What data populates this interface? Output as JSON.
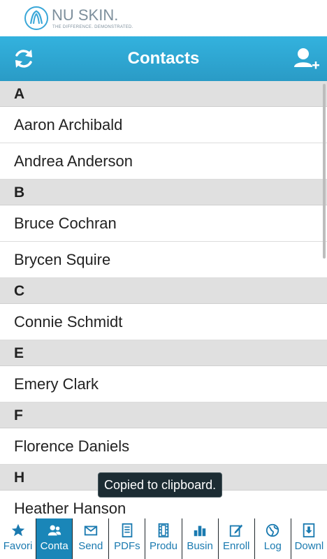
{
  "brand": {
    "name": "NU SKIN.",
    "tagline": "THE DIFFERENCE. DEMONSTRATED."
  },
  "header": {
    "title": "Contacts",
    "refresh_icon": "refresh-icon",
    "add_icon": "add-contact-icon"
  },
  "contacts": {
    "sections": [
      {
        "letter": "A",
        "names": [
          "Aaron Archibald",
          "Andrea Anderson"
        ]
      },
      {
        "letter": "B",
        "names": [
          "Bruce Cochran",
          "Brycen Squire"
        ]
      },
      {
        "letter": "C",
        "names": [
          "Connie Schmidt"
        ]
      },
      {
        "letter": "E",
        "names": [
          "Emery Clark"
        ]
      },
      {
        "letter": "F",
        "names": [
          "Florence Daniels"
        ]
      },
      {
        "letter": "H",
        "names": [
          "Heather Hanson"
        ]
      }
    ]
  },
  "toast": {
    "text": "Copied to clipboard."
  },
  "tabs": [
    {
      "label": "Favori",
      "icon": "star-icon",
      "active": false
    },
    {
      "label": "Conta",
      "icon": "contacts-icon",
      "active": true
    },
    {
      "label": "Send",
      "icon": "envelope-icon",
      "active": false
    },
    {
      "label": "PDFs",
      "icon": "document-icon",
      "active": false
    },
    {
      "label": "Produ",
      "icon": "film-icon",
      "active": false
    },
    {
      "label": "Busin",
      "icon": "bar-chart-icon",
      "active": false
    },
    {
      "label": "Enroll",
      "icon": "edit-icon",
      "active": false
    },
    {
      "label": "Log",
      "icon": "globe-icon",
      "active": false
    },
    {
      "label": "Downl",
      "icon": "download-icon",
      "active": false
    }
  ],
  "colors": {
    "accent": "#2a9bc6",
    "active_tab": "#1a86b8",
    "section_bg": "#e0e0e0"
  }
}
